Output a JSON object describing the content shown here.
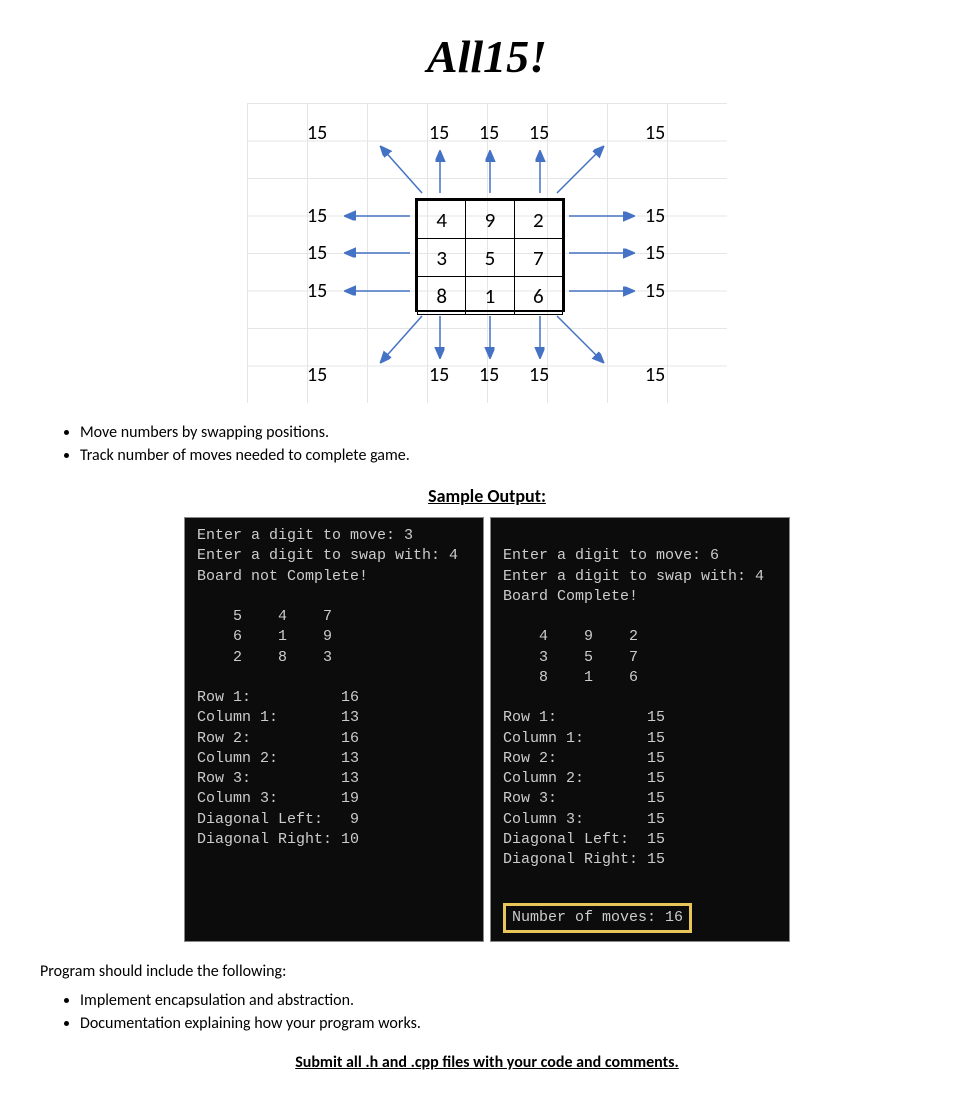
{
  "title": "All15!",
  "diagram": {
    "outerValue": "15",
    "grid": [
      [
        "4",
        "9",
        "2"
      ],
      [
        "3",
        "5",
        "7"
      ],
      [
        "8",
        "1",
        "6"
      ]
    ]
  },
  "topBullets": [
    "Move numbers by swapping positions.",
    "Track number of moves needed to complete game."
  ],
  "sampleHeading": "Sample Output:",
  "terminalLeft": "Enter a digit to move: 3\nEnter a digit to swap with: 4\nBoard not Complete!\n\n    5    4    7\n    6    1    9\n    2    8    3\n\nRow 1:          16\nColumn 1:       13\nRow 2:          16\nColumn 2:       13\nRow 3:          13\nColumn 3:       19\nDiagonal Left:   9\nDiagonal Right: 10",
  "terminalRightTop": "Enter a digit to move: 6\nEnter a digit to swap with: 4\nBoard Complete!\n\n    4    9    2\n    3    5    7\n    8    1    6\n\nRow 1:          15\nColumn 1:       15\nRow 2:          15\nColumn 2:       15\nRow 3:          15\nColumn 3:       15\nDiagonal Left:  15\nDiagonal Right: 15",
  "terminalRightHighlight": "Number of moves: 16",
  "midPara": "Program should include the following:",
  "bottomBullets": [
    "Implement encapsulation and abstraction.",
    "Documentation explaining how your program works."
  ],
  "submitLine": "Submit all .h and .cpp files with your code and comments."
}
